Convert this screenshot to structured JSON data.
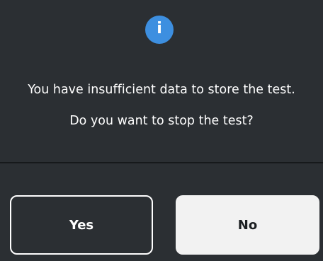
{
  "dialog": {
    "icon": "info-icon",
    "icon_glyph": "i",
    "icon_color": "#3d8fe0",
    "message_line_1": "You have insufficient data to store the test.",
    "message_line_2": "Do you want to stop the test?",
    "background_color": "#2b2f33"
  },
  "buttons": {
    "yes_label": "Yes",
    "no_label": "No"
  }
}
